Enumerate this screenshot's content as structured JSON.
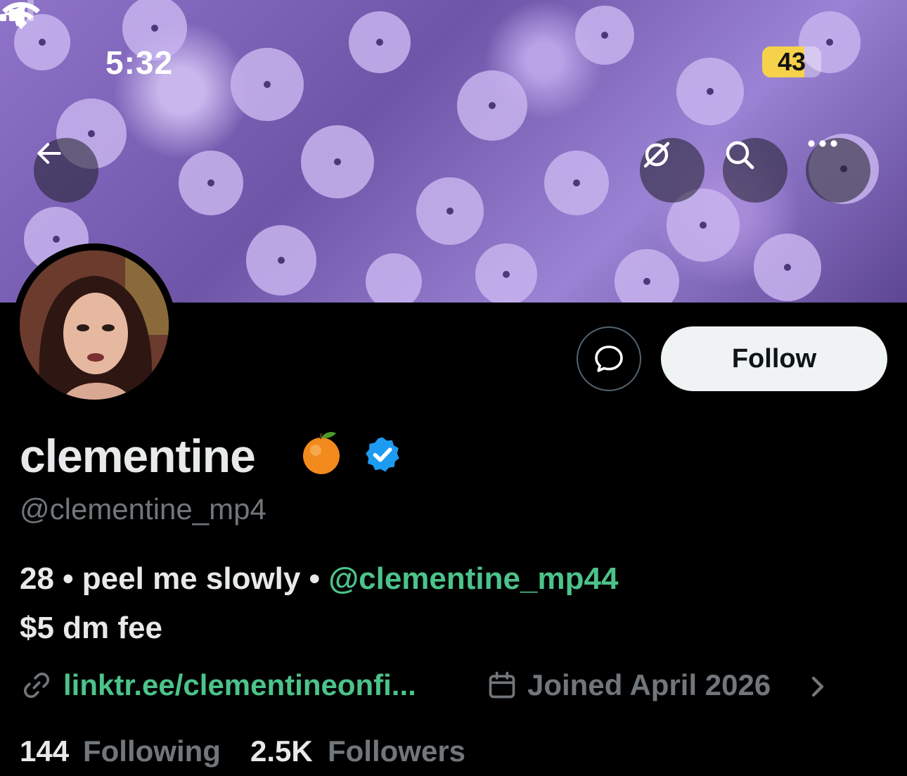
{
  "status_bar": {
    "time": "5:32",
    "battery": "43"
  },
  "banner": {
    "image": "purple phlox flowers"
  },
  "icons": {
    "back": "arrow-left-icon",
    "translate": "translate-icon",
    "search": "search-icon",
    "more": "more-icon",
    "dm": "message-icon",
    "link": "link-icon",
    "calendar": "calendar-icon"
  },
  "profile": {
    "display_name": "clementine",
    "name_emoji": "orange",
    "handle": "@clementine_mp4",
    "bio_line1_prefix": "28 • peel me slowly • ",
    "bio_mention": "@clementine_mp44",
    "bio_line2": "$5 dm fee",
    "link": "linktr.ee/clementineonfi...",
    "joined": "Joined April 2026",
    "following_count": "144",
    "following_label": "Following",
    "followers_count": "2.5K",
    "followers_label": "Followers"
  },
  "actions": {
    "follow_label": "Follow"
  },
  "colors": {
    "accent_green": "#4cc38a",
    "verified_blue": "#1d9bf0",
    "muted": "#71767b"
  }
}
